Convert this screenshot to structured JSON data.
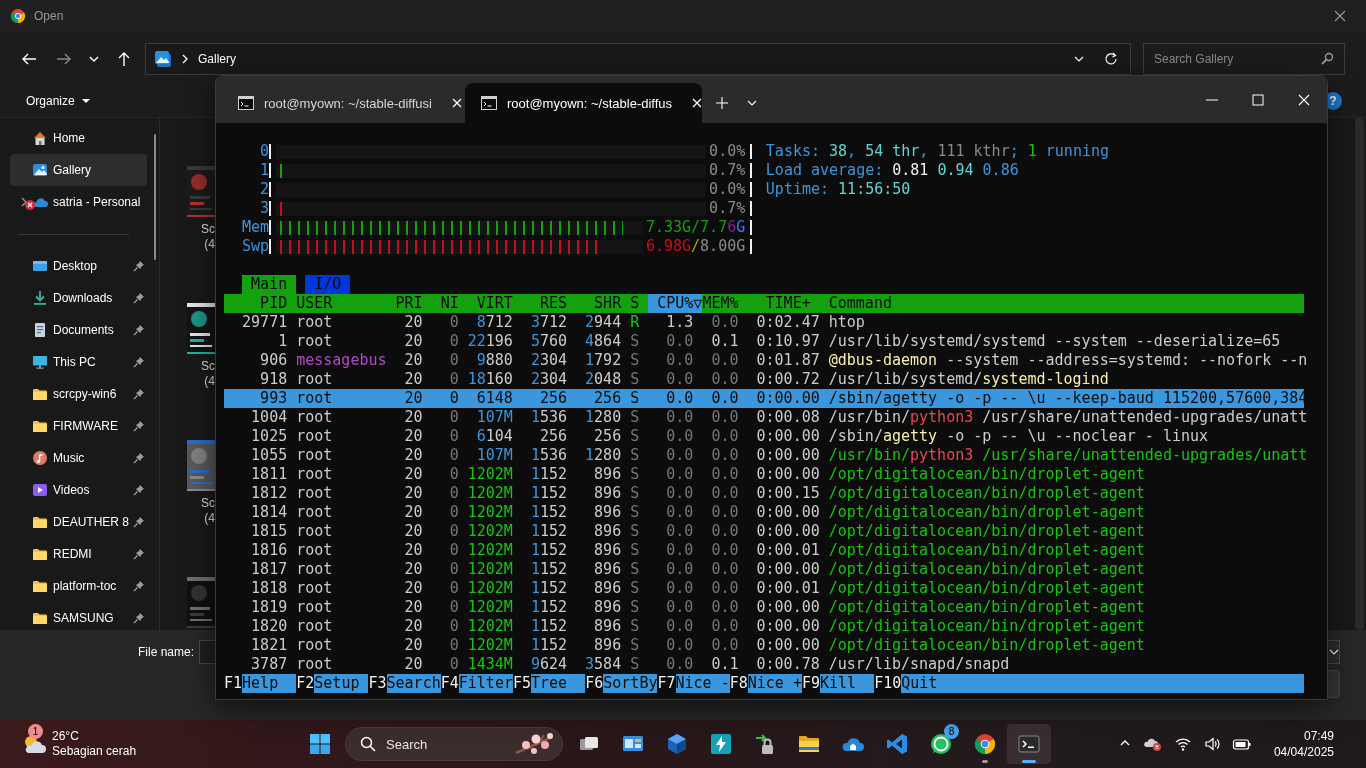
{
  "dialog": {
    "title": "Open",
    "nav": [
      {
        "kind": "back",
        "disabled": false
      },
      {
        "kind": "forward",
        "disabled": true
      },
      {
        "kind": "recent",
        "disabled": false
      },
      {
        "kind": "up",
        "disabled": false
      }
    ],
    "address": {
      "crumbs": [
        "Gallery"
      ]
    },
    "search": {
      "placeholder": "Search Gallery"
    },
    "toolbar": {
      "organize": "Organize",
      "help": "?"
    },
    "sidebar": {
      "top": [
        {
          "kind": "home",
          "label": "Home",
          "selected": false,
          "pinned": false,
          "error": false
        },
        {
          "kind": "gallery",
          "label": "Gallery",
          "selected": true,
          "pinned": false,
          "error": false
        },
        {
          "kind": "cloud",
          "label": "satria - Personal",
          "selected": false,
          "pinned": false,
          "error": true,
          "expanded": false
        }
      ],
      "quick_access": [
        {
          "kind": "desktop",
          "label": "Desktop",
          "selected": false,
          "pinned": true,
          "error": false
        },
        {
          "kind": "downloads",
          "label": "Downloads",
          "selected": false,
          "pinned": true,
          "error": false
        },
        {
          "kind": "documents",
          "label": "Documents",
          "selected": false,
          "pinned": true,
          "error": false
        },
        {
          "kind": "pc",
          "label": "This PC",
          "selected": false,
          "pinned": true,
          "error": false
        },
        {
          "kind": "folder",
          "label": "scrcpy-win6",
          "selected": false,
          "pinned": true,
          "error": false
        },
        {
          "kind": "folder",
          "label": "FIRMWARE",
          "selected": false,
          "pinned": true,
          "error": false
        },
        {
          "kind": "music",
          "label": "Music",
          "selected": false,
          "pinned": true,
          "error": false
        },
        {
          "kind": "videos",
          "label": "Videos",
          "selected": false,
          "pinned": true,
          "error": false
        },
        {
          "kind": "folder",
          "label": "DEAUTHER 8",
          "selected": false,
          "pinned": true,
          "error": false
        },
        {
          "kind": "folder",
          "label": "REDMI",
          "selected": false,
          "pinned": true,
          "error": false
        },
        {
          "kind": "folder",
          "label": "platform-toc",
          "selected": false,
          "pinned": true,
          "error": false
        },
        {
          "kind": "folder",
          "label": "SAMSUNG",
          "selected": false,
          "pinned": true,
          "error": false
        }
      ]
    },
    "thumbnails": [
      {
        "kind": "picture",
        "name": "Sc",
        "detail": "(4"
      },
      {
        "kind": "picture",
        "name": "Sc",
        "detail": "(4"
      },
      {
        "kind": "picture",
        "name": "Sc",
        "detail": "(4"
      },
      {
        "kind": "picture"
      }
    ],
    "file_name": {
      "label": "File name:"
    }
  },
  "terminal": {
    "tabs": [
      {
        "title": "root@myown: ~/stable-diffusi",
        "selected": false
      },
      {
        "title": "root@myown: ~/stable-diffus",
        "selected": true
      }
    ],
    "htop": {
      "meters": [
        {
          "label": "0",
          "level": 0,
          "value_parts": [
            {
              "text": "0.0%",
              "color": "#8a8a8a"
            }
          ]
        },
        {
          "label": "1",
          "level": 0.007,
          "color": "#13a10e",
          "value_parts": [
            {
              "text": "0.7%",
              "color": "#8a8a8a"
            }
          ]
        },
        {
          "label": "2",
          "level": 0,
          "value_parts": [
            {
              "text": "0.0%",
              "color": "#8a8a8a"
            }
          ]
        },
        {
          "label": "3",
          "level": 0.007,
          "color": "#c50f1f",
          "value_parts": [
            {
              "text": "0.7%",
              "color": "#8a8a8a"
            }
          ]
        },
        {
          "label": "Mem",
          "level": 0.945,
          "color": "#13a10e",
          "value_parts": [
            {
              "text": "7.33G/7.7",
              "color": "#13a10e"
            },
            {
              "text": "6",
              "color": "#881798"
            },
            {
              "text": "G",
              "color": "#3b78ff"
            }
          ]
        },
        {
          "label": "Swp",
          "level": 0.873,
          "color": "#c50f1f",
          "value_parts": [
            {
              "text": "6.98G",
              "color": "#c50f1f"
            },
            {
              "text": "/",
              "color": "#c19c00"
            },
            {
              "text": "8.00G",
              "color": "#8a8a8a"
            }
          ]
        }
      ],
      "summary": [
        [
          {
            "text": "Tasks: ",
            "color": "#3a96dd"
          },
          {
            "text": "38",
            "color": "#61d6d6"
          },
          {
            "text": ", ",
            "color": "#3a96dd"
          },
          {
            "text": "54 thr",
            "color": "#61d6d6"
          },
          {
            "text": ", ",
            "color": "#3a96dd"
          },
          {
            "text": "111 kthr",
            "color": "#8a8a8a"
          },
          {
            "text": "; ",
            "color": "#3a96dd"
          },
          {
            "text": "1",
            "color": "#16c60c"
          },
          {
            "text": " running",
            "color": "#3a96dd"
          }
        ],
        [
          {
            "text": "Load average: ",
            "color": "#3a96dd"
          },
          {
            "text": "0.81 ",
            "color": "#f2f2f2"
          },
          {
            "text": "0.94 ",
            "color": "#61d6d6"
          },
          {
            "text": "0.86",
            "color": "#3a96dd"
          }
        ],
        [
          {
            "text": "Uptime: ",
            "color": "#3a96dd"
          },
          {
            "text": "11:56:50",
            "color": "#61d6d6"
          }
        ]
      ],
      "views": [
        {
          "label": "Main",
          "selected": true
        },
        {
          "label": "I/O",
          "selected": false
        }
      ],
      "columns": [
        {
          "label": "PID",
          "selected": false
        },
        {
          "label": "USER",
          "selected": false
        },
        {
          "label": "PRI",
          "selected": false
        },
        {
          "label": "NI",
          "selected": false
        },
        {
          "label": "VIRT",
          "selected": false
        },
        {
          "label": "RES",
          "selected": false
        },
        {
          "label": "SHR",
          "selected": false
        },
        {
          "label": "S",
          "selected": false
        },
        {
          "label": "CPU%▽",
          "selected": true
        },
        {
          "label": "MEM%",
          "selected": false
        },
        {
          "label": "TIME+",
          "selected": false
        },
        {
          "label": "Command",
          "selected": false
        }
      ],
      "rows": [
        {
          "pid": "29771",
          "user": "root",
          "pri": "20",
          "ni": "0",
          "virt": "8712",
          "res": "3712",
          "shr": "2944",
          "s": "R",
          "cpu": "1.3",
          "mem": "0.0",
          "time": "0:02.47",
          "command": [
            {
              "text": "htop",
              "kind": "plain"
            }
          ],
          "running": true,
          "other_user": false,
          "selected": false
        },
        {
          "pid": "1",
          "user": "root",
          "pri": "20",
          "ni": "0",
          "virt": "22196",
          "res": "5760",
          "shr": "4864",
          "s": "S",
          "cpu": "0.0",
          "mem": "0.1",
          "time": "0:10.97",
          "command": [
            {
              "text": "/usr/lib/systemd/systemd --system --deserialize=65",
              "kind": "plain"
            }
          ],
          "running": false,
          "other_user": false,
          "selected": false
        },
        {
          "pid": "906",
          "user": "messagebus",
          "pri": "20",
          "ni": "0",
          "virt": "9880",
          "res": "2304",
          "shr": "1792",
          "s": "S",
          "cpu": "0.0",
          "mem": "0.0",
          "time": "0:01.87",
          "command": [
            {
              "text": "@dbus-daemon",
              "kind": "name"
            },
            {
              "text": " --system --address=systemd: --nofork --n",
              "kind": "plain"
            }
          ],
          "running": false,
          "other_user": true,
          "selected": false
        },
        {
          "pid": "918",
          "user": "root",
          "pri": "20",
          "ni": "0",
          "virt": "18160",
          "res": "2304",
          "shr": "2048",
          "s": "S",
          "cpu": "0.0",
          "mem": "0.0",
          "time": "0:00.72",
          "command": [
            {
              "text": "/usr/lib/systemd/",
              "kind": "plain"
            },
            {
              "text": "systemd-logind",
              "kind": "name"
            }
          ],
          "running": false,
          "other_user": false,
          "selected": false
        },
        {
          "pid": "993",
          "user": "root",
          "pri": "20",
          "ni": "0",
          "virt": "6148",
          "res": "256",
          "shr": "256",
          "s": "S",
          "cpu": "0.0",
          "mem": "0.0",
          "time": "0:00.00",
          "command": [
            {
              "text": "/sbin/",
              "kind": "plain"
            },
            {
              "text": "agetty",
              "kind": "name"
            },
            {
              "text": " -o -p -- \\u --keep-baud 115200,57600,384",
              "kind": "plain"
            }
          ],
          "running": false,
          "other_user": false,
          "selected": true
        },
        {
          "pid": "1004",
          "user": "root",
          "pri": "20",
          "ni": "0",
          "virt": "107M",
          "res": "1536",
          "shr": "1280",
          "s": "S",
          "cpu": "0.0",
          "mem": "0.0",
          "time": "0:00.08",
          "command": [
            {
              "text": "/usr/bin/",
              "kind": "plain"
            },
            {
              "text": "python3",
              "kind": "interp"
            },
            {
              "text": " /usr/share/unattended-upgrades/unatt",
              "kind": "plain"
            }
          ],
          "running": false,
          "other_user": false,
          "selected": false
        },
        {
          "pid": "1025",
          "user": "root",
          "pri": "20",
          "ni": "0",
          "virt": "6104",
          "res": "256",
          "shr": "256",
          "s": "S",
          "cpu": "0.0",
          "mem": "0.0",
          "time": "0:00.00",
          "command": [
            {
              "text": "/sbin/",
              "kind": "plain"
            },
            {
              "text": "agetty",
              "kind": "name"
            },
            {
              "text": " -o -p -- \\u --noclear - linux",
              "kind": "plain"
            }
          ],
          "running": false,
          "other_user": false,
          "selected": false
        },
        {
          "pid": "1055",
          "user": "root",
          "pri": "20",
          "ni": "0",
          "virt": "107M",
          "res": "1536",
          "shr": "1280",
          "s": "S",
          "cpu": "0.0",
          "mem": "0.0",
          "time": "0:00.00",
          "command": [
            {
              "text": "/usr/bin/",
              "kind": "thread"
            },
            {
              "text": "python3",
              "kind": "interp"
            },
            {
              "text": " /usr/share/unattended-upgrades/unatt",
              "kind": "thread"
            }
          ],
          "running": false,
          "other_user": false,
          "selected": false
        },
        {
          "pid": "1811",
          "user": "root",
          "pri": "20",
          "ni": "0",
          "virt": "1202M",
          "res": "1152",
          "shr": "896",
          "s": "S",
          "cpu": "0.0",
          "mem": "0.0",
          "time": "0:00.00",
          "command": [
            {
              "text": "/opt/digitalocean/bin/droplet-agent",
              "kind": "thread"
            }
          ],
          "running": false,
          "other_user": false,
          "selected": false
        },
        {
          "pid": "1812",
          "user": "root",
          "pri": "20",
          "ni": "0",
          "virt": "1202M",
          "res": "1152",
          "shr": "896",
          "s": "S",
          "cpu": "0.0",
          "mem": "0.0",
          "time": "0:00.15",
          "command": [
            {
              "text": "/opt/digitalocean/bin/droplet-agent",
              "kind": "thread"
            }
          ],
          "running": false,
          "other_user": false,
          "selected": false
        },
        {
          "pid": "1814",
          "user": "root",
          "pri": "20",
          "ni": "0",
          "virt": "1202M",
          "res": "1152",
          "shr": "896",
          "s": "S",
          "cpu": "0.0",
          "mem": "0.0",
          "time": "0:00.00",
          "command": [
            {
              "text": "/opt/digitalocean/bin/droplet-agent",
              "kind": "thread"
            }
          ],
          "running": false,
          "other_user": false,
          "selected": false
        },
        {
          "pid": "1815",
          "user": "root",
          "pri": "20",
          "ni": "0",
          "virt": "1202M",
          "res": "1152",
          "shr": "896",
          "s": "S",
          "cpu": "0.0",
          "mem": "0.0",
          "time": "0:00.00",
          "command": [
            {
              "text": "/opt/digitalocean/bin/droplet-agent",
              "kind": "thread"
            }
          ],
          "running": false,
          "other_user": false,
          "selected": false
        },
        {
          "pid": "1816",
          "user": "root",
          "pri": "20",
          "ni": "0",
          "virt": "1202M",
          "res": "1152",
          "shr": "896",
          "s": "S",
          "cpu": "0.0",
          "mem": "0.0",
          "time": "0:00.01",
          "command": [
            {
              "text": "/opt/digitalocean/bin/droplet-agent",
              "kind": "thread"
            }
          ],
          "running": false,
          "other_user": false,
          "selected": false
        },
        {
          "pid": "1817",
          "user": "root",
          "pri": "20",
          "ni": "0",
          "virt": "1202M",
          "res": "1152",
          "shr": "896",
          "s": "S",
          "cpu": "0.0",
          "mem": "0.0",
          "time": "0:00.00",
          "command": [
            {
              "text": "/opt/digitalocean/bin/droplet-agent",
              "kind": "thread"
            }
          ],
          "running": false,
          "other_user": false,
          "selected": false
        },
        {
          "pid": "1818",
          "user": "root",
          "pri": "20",
          "ni": "0",
          "virt": "1202M",
          "res": "1152",
          "shr": "896",
          "s": "S",
          "cpu": "0.0",
          "mem": "0.0",
          "time": "0:00.01",
          "command": [
            {
              "text": "/opt/digitalocean/bin/droplet-agent",
              "kind": "thread"
            }
          ],
          "running": false,
          "other_user": false,
          "selected": false
        },
        {
          "pid": "1819",
          "user": "root",
          "pri": "20",
          "ni": "0",
          "virt": "1202M",
          "res": "1152",
          "shr": "896",
          "s": "S",
          "cpu": "0.0",
          "mem": "0.0",
          "time": "0:00.00",
          "command": [
            {
              "text": "/opt/digitalocean/bin/droplet-agent",
              "kind": "thread"
            }
          ],
          "running": false,
          "other_user": false,
          "selected": false
        },
        {
          "pid": "1820",
          "user": "root",
          "pri": "20",
          "ni": "0",
          "virt": "1202M",
          "res": "1152",
          "shr": "896",
          "s": "S",
          "cpu": "0.0",
          "mem": "0.0",
          "time": "0:00.00",
          "command": [
            {
              "text": "/opt/digitalocean/bin/droplet-agent",
              "kind": "thread"
            }
          ],
          "running": false,
          "other_user": false,
          "selected": false
        },
        {
          "pid": "1821",
          "user": "root",
          "pri": "20",
          "ni": "0",
          "virt": "1202M",
          "res": "1152",
          "shr": "896",
          "s": "S",
          "cpu": "0.0",
          "mem": "0.0",
          "time": "0:00.00",
          "command": [
            {
              "text": "/opt/digitalocean/bin/droplet-agent",
              "kind": "thread"
            }
          ],
          "running": false,
          "other_user": false,
          "selected": false
        },
        {
          "pid": "3787",
          "user": "root",
          "pri": "20",
          "ni": "0",
          "virt": "1434M",
          "res": "9624",
          "shr": "3584",
          "s": "S",
          "cpu": "0.0",
          "mem": "0.1",
          "time": "0:00.78",
          "command": [
            {
              "text": "/usr/lib/snapd/snapd",
              "kind": "plain"
            }
          ],
          "running": false,
          "other_user": false,
          "selected": false
        }
      ],
      "function_keys": [
        {
          "key": "F1",
          "label": "Help"
        },
        {
          "key": "F2",
          "label": "Setup"
        },
        {
          "key": "F3",
          "label": "Search"
        },
        {
          "key": "F4",
          "label": "Filter"
        },
        {
          "key": "F5",
          "label": "Tree"
        },
        {
          "key": "F6",
          "label": "SortBy"
        },
        {
          "key": "F7",
          "label": "Nice -"
        },
        {
          "key": "F8",
          "label": "Nice +"
        },
        {
          "key": "F9",
          "label": "Kill"
        },
        {
          "key": "F10",
          "label": "Quit"
        }
      ]
    }
  },
  "taskbar": {
    "weather": {
      "badge": "1",
      "temperature": "26°C",
      "condition": "Sebagian cerah"
    },
    "search": {
      "placeholder": "Search"
    },
    "apps": [
      {
        "kind": "taskview",
        "running": false,
        "selected": false
      },
      {
        "kind": "controlpanel",
        "running": false,
        "selected": false
      },
      {
        "kind": "virtualbox",
        "running": false,
        "selected": false
      },
      {
        "kind": "bolt",
        "running": false,
        "selected": false
      },
      {
        "kind": "lock",
        "running": false,
        "selected": false
      },
      {
        "kind": "explorer",
        "running": false,
        "selected": false
      },
      {
        "kind": "cloud",
        "running": false,
        "selected": false
      },
      {
        "kind": "vscode",
        "running": false,
        "selected": false
      },
      {
        "kind": "whatsapp",
        "running": false,
        "selected": false,
        "badge": "8"
      },
      {
        "kind": "chrome",
        "running": true,
        "selected": false
      },
      {
        "kind": "terminal",
        "running": true,
        "selected": true
      }
    ],
    "tray": [
      {
        "kind": "overflow"
      },
      {
        "kind": "onedrive"
      },
      {
        "kind": "wifi"
      },
      {
        "kind": "volume"
      },
      {
        "kind": "battery"
      }
    ],
    "clock": {
      "time": "07:49",
      "date": "04/04/2025"
    }
  }
}
